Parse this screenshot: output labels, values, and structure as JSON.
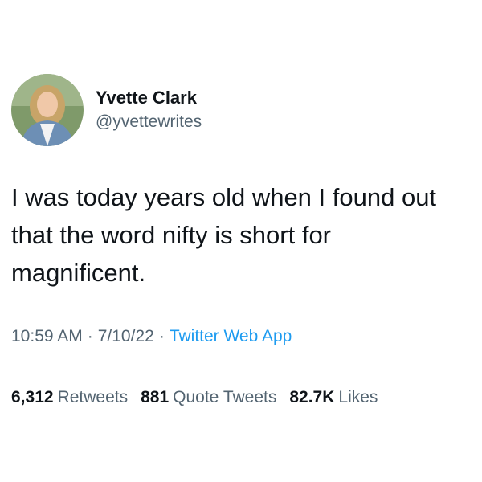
{
  "author": {
    "display_name": "Yvette Clark",
    "handle": "@yvettewrites",
    "avatar_icon": "profile-photo"
  },
  "tweet": {
    "text": "I was today years old when I found out that the word nifty is short for magnificent."
  },
  "meta": {
    "time": "10:59 AM",
    "separator": "·",
    "date": "7/10/22",
    "source": "Twitter Web App"
  },
  "stats": {
    "retweets_count": "6,312",
    "retweets_label": "Retweets",
    "quote_tweets_count": "881",
    "quote_tweets_label": "Quote Tweets",
    "likes_count": "82.7K",
    "likes_label": "Likes"
  },
  "colors": {
    "text_primary": "#0f1419",
    "text_secondary": "#536471",
    "link": "#1d9bf0",
    "divider": "#cfd9de"
  }
}
